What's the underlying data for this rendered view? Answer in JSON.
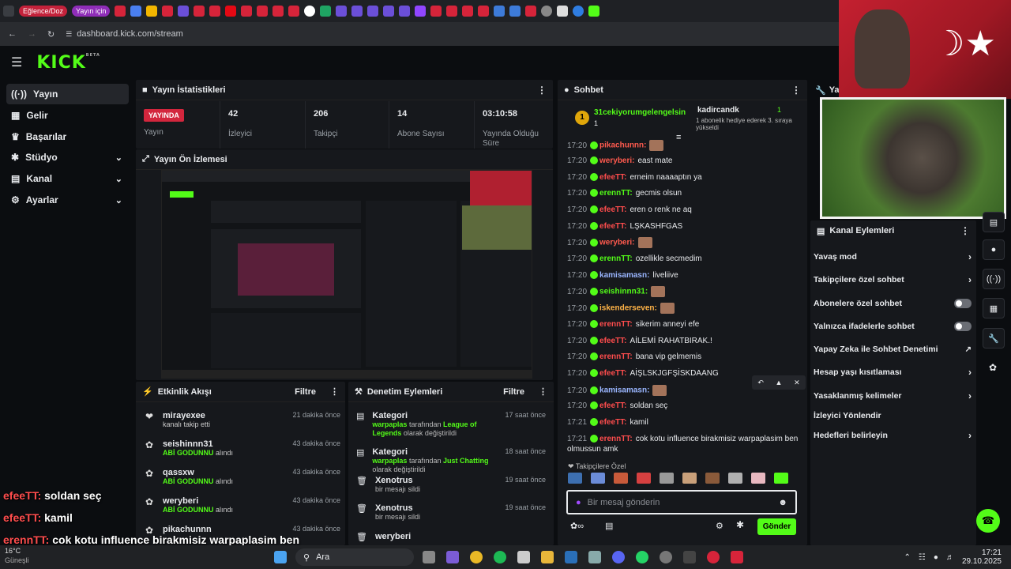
{
  "tabs": {
    "pill1": "Eğlence/Doz",
    "pill2": "Yayın için"
  },
  "address": {
    "url": "dashboard.kick.com/stream"
  },
  "nav": {
    "logo": "KICK",
    "beta": "BETA"
  },
  "sidebar": {
    "items": [
      {
        "label": "Yayın",
        "icon": "broadcast-icon"
      },
      {
        "label": "Gelir",
        "icon": "money-icon"
      },
      {
        "label": "Başarılar",
        "icon": "trophy-icon"
      },
      {
        "label": "Stüdyo",
        "icon": "studio-icon"
      },
      {
        "label": "Kanal",
        "icon": "channel-icon"
      },
      {
        "label": "Ayarlar",
        "icon": "gear-icon"
      }
    ]
  },
  "stats": {
    "title": "Yayın İstatistikleri",
    "live_badge": "YAYINDA",
    "live_label": "Yayın",
    "viewers": "42",
    "viewers_label": "İzleyici",
    "followers": "206",
    "followers_label": "Takipçi",
    "subs": "14",
    "subs_label": "Abone Sayısı",
    "duration": "03:10:58",
    "duration_label": "Yayında Olduğu Süre"
  },
  "preview": {
    "title": "Yayın Ön İzlemesi"
  },
  "activity": {
    "title": "Etkinlik Akışı",
    "filter": "Filtre",
    "rows": [
      {
        "name": "mirayexee",
        "sub": "kanalı takip etti",
        "time": "21 dakika önce",
        "type": "follow"
      },
      {
        "name": "seishinnn31",
        "sub": "ABİ GODUNNU",
        "sub2": "alındı",
        "time": "43 dakika önce",
        "type": "redeem"
      },
      {
        "name": "qassxw",
        "sub": "ABİ GODUNNU",
        "sub2": "alındı",
        "time": "43 dakika önce",
        "type": "redeem"
      },
      {
        "name": "weryberi",
        "sub": "ABİ GODUNNU",
        "sub2": "alındı",
        "time": "43 dakika önce",
        "type": "redeem"
      },
      {
        "name": "pikachunnn",
        "sub": "",
        "sub2": "",
        "time": "43 dakika önce",
        "type": "redeem"
      }
    ]
  },
  "moderation": {
    "title": "Denetim Eylemleri",
    "filter": "Filtre",
    "rows": [
      {
        "name": "Kategori",
        "user": "warpaplas",
        "mid": " tarafından ",
        "game": "League of Legends",
        "rest": " olarak değiştirildi",
        "time": "17 saat önce"
      },
      {
        "name": "Kategori",
        "user": "warpaplas",
        "mid": " tarafından ",
        "game": "Just Chatting",
        "rest": " olarak değiştirildi",
        "time": "18 saat önce"
      },
      {
        "name": "Xenotrus",
        "user": "",
        "mid": "bir mesajı sildi",
        "game": "",
        "rest": "",
        "time": "19 saat önce"
      },
      {
        "name": "Xenotrus",
        "user": "",
        "mid": "bir mesajı sildi",
        "game": "",
        "rest": "",
        "time": "19 saat önce"
      },
      {
        "name": "weryberi",
        "user": "",
        "mid": "",
        "game": "",
        "rest": "",
        "time": ""
      }
    ]
  },
  "chat": {
    "title": "Sohbet",
    "pinned1": {
      "name": "31cekiyorumgelengelsin",
      "count": "1"
    },
    "pinned2": {
      "name": "kadircandk",
      "count": "1",
      "text": "1 abonelik hediye ederek 3. sıraya yükseldi"
    },
    "messages": [
      {
        "time": "17:20",
        "user": "pikachunnn:",
        "color": "#ff5a4e",
        "text": "",
        "emote": true
      },
      {
        "time": "17:20",
        "user": "weryberi:",
        "color": "#ff5a4e",
        "text": "east mate",
        "emote": false
      },
      {
        "time": "17:20",
        "user": "efeeTT:",
        "color": "#ff4d4d",
        "text": "erneim naaaaptın ya",
        "emote": false
      },
      {
        "time": "17:20",
        "user": "erennTT:",
        "color": "#53fc18",
        "text": "gecmis olsun",
        "emote": false
      },
      {
        "time": "17:20",
        "user": "efeeTT:",
        "color": "#ff4d4d",
        "text": "eren o renk ne aq",
        "emote": false
      },
      {
        "time": "17:20",
        "user": "efeeTT:",
        "color": "#ff4d4d",
        "text": "LŞKASHFGAS",
        "emote": false
      },
      {
        "time": "17:20",
        "user": "weryberi:",
        "color": "#ff5a4e",
        "text": "",
        "emote": true
      },
      {
        "time": "17:20",
        "user": "erennTT:",
        "color": "#53fc18",
        "text": "ozellikle secmedim",
        "emote": false
      },
      {
        "time": "17:20",
        "user": "kamisamasn:",
        "color": "#9ab6ff",
        "text": "liveliive",
        "emote": false
      },
      {
        "time": "17:20",
        "user": "seishinnn31:",
        "color": "#53fc18",
        "text": "",
        "emote": true
      },
      {
        "time": "17:20",
        "user": "iskenderseven:",
        "color": "#ffb347",
        "text": "",
        "emote": true
      },
      {
        "time": "17:20",
        "user": "erennTT:",
        "color": "#ff4d4d",
        "text": "sikerim anneyi efe",
        "emote": false
      },
      {
        "time": "17:20",
        "user": "efeeTT:",
        "color": "#ff4d4d",
        "text": "AİLEMİ RAHATBIRAK.!",
        "emote": false
      },
      {
        "time": "17:20",
        "user": "erennTT:",
        "color": "#ff4d4d",
        "text": "bana vip gelmemis",
        "emote": false
      },
      {
        "time": "17:20",
        "user": "efeeTT:",
        "color": "#ff4d4d",
        "text": "AİŞLSKJGFŞİSKDAANG",
        "emote": false
      },
      {
        "time": "17:20",
        "user": "kamisamasn:",
        "color": "#9ab6ff",
        "text": "",
        "emote": true
      },
      {
        "time": "17:20",
        "user": "efeeTT:",
        "color": "#ff4d4d",
        "text": "soldan seç",
        "emote": false
      },
      {
        "time": "17:21",
        "user": "efeeTT:",
        "color": "#ff4d4d",
        "text": "kamil",
        "emote": false
      },
      {
        "time": "17:21",
        "user": "erennTT:",
        "color": "#ff4d4d",
        "text": "cok kotu influence birakmisiz warpaplasim ben",
        "emote": false
      }
    ],
    "last_cont": "olmussun amk",
    "emote_label": "Takipçilere Özel",
    "placeholder": "Bir mesaj gönderin",
    "send": "Gönder"
  },
  "channel_actions": {
    "title": "Kanal Eylemleri",
    "items": [
      {
        "label": "Yavaş mod",
        "kind": "arrow"
      },
      {
        "label": "Takipçilere özel sohbet",
        "kind": "arrow"
      },
      {
        "label": "Abonelere özel sohbet",
        "kind": "toggle"
      },
      {
        "label": "Yalnızca ifadelerle sohbet",
        "kind": "toggle"
      },
      {
        "label": "Yapay Zeka ile Sohbet Denetimi",
        "kind": "ext"
      },
      {
        "label": "Hesap yaşı kısıtlaması",
        "kind": "arrow"
      },
      {
        "label": "Yasaklanmış kelimeler",
        "kind": "arrow"
      },
      {
        "label": "İzleyici Yönlendir",
        "kind": "none"
      },
      {
        "label": "Hedefleri belirleyin",
        "kind": "arrow"
      }
    ]
  },
  "right_panel": {
    "title": "Yay"
  },
  "overlay": {
    "lines": [
      {
        "user": "efeeTT:",
        "text": "soldan seç"
      },
      {
        "user": "efeeTT:",
        "text": "kamil"
      },
      {
        "user": "erennTT:",
        "text": "cok kotu influence birakmisiz warpaplasim ben"
      },
      {
        "user": "",
        "text": "olmussun amk"
      }
    ]
  },
  "taskbar": {
    "search": "Ara",
    "time": "17:21",
    "date": "29.10.2025",
    "weather": "16°C",
    "weather_sub": "Güneşli"
  }
}
